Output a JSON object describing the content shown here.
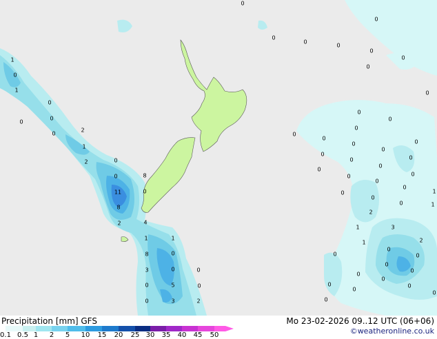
{
  "map": {
    "colors": {
      "sea": "#ebebeb",
      "land": "#ccf5a0",
      "coast": "#5a5a5a",
      "p01": "#d6f7f7",
      "p05": "#b8ecf0",
      "p1": "#96dfea",
      "p2": "#6fcbe6",
      "p5": "#4db2e6",
      "p10": "#3a8ee0",
      "p15": "#2a6dcc"
    },
    "values": [
      "0",
      "1",
      "0",
      "1",
      "0",
      "0",
      "0",
      "2",
      "0",
      "1",
      "2",
      "0",
      "0",
      "11",
      "8",
      "8",
      "0",
      "2",
      "4",
      "1",
      "1",
      "8",
      "0",
      "3",
      "0",
      "5",
      "0",
      "0",
      "3",
      "2",
      "0",
      "0",
      "0",
      "0",
      "0",
      "0",
      "0",
      "0",
      "0",
      "0",
      "0",
      "0",
      "0",
      "0",
      "0",
      "0",
      "0",
      "0",
      "0",
      "0",
      "0",
      "0",
      "0",
      "0",
      "0",
      "0",
      "0",
      "1",
      "0",
      "0",
      "0",
      "1",
      "2",
      "1",
      "3",
      "2",
      "1",
      "0",
      "0",
      "0",
      "0",
      "0",
      "0",
      "0",
      "0",
      "0",
      "0",
      "0",
      "0"
    ]
  },
  "footer": {
    "title": "Precipitation [mm]  GFS",
    "run": "Mo 23-02-2026 09..12 UTC (06+06)",
    "credit": "©weatheronline.co.uk",
    "scale_ticks": [
      "0.1",
      "0.5",
      "1",
      "2",
      "5",
      "10",
      "15",
      "20",
      "25",
      "30",
      "35",
      "40",
      "45",
      "50"
    ],
    "scale_colors": [
      "#e8fafa",
      "#c8f0f0",
      "#a0e6f0",
      "#78d2ee",
      "#50bcea",
      "#2d9be0",
      "#1e7acc",
      "#1450aa",
      "#0a2d82",
      "#7a1ea8",
      "#a028c8",
      "#c832d2",
      "#e646dc",
      "#ff5ae6"
    ]
  }
}
